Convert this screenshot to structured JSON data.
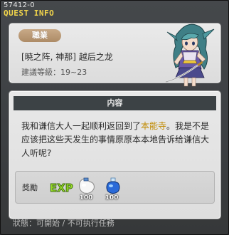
{
  "window": {
    "quest_id": "57412-0",
    "title": "QUEST INFO"
  },
  "summary": {
    "job_label": "職業",
    "quest_name": "[暁之阵, 神那] 越后之龙",
    "level_requirement": "建議等級：19~23"
  },
  "content": {
    "header": "内容",
    "text_part1": "我和谦信大人一起顺利返回到了",
    "text_highlight": "本能寺",
    "text_part2": "。我是不是应该把这些天发生的事情原原本本地告诉给谦信大人听呢?",
    "highlight_color": "#c08a00"
  },
  "reward": {
    "label": "獎勵",
    "exp_text": "EXP",
    "items": [
      {
        "icon": "white-potion-icon",
        "count": "100"
      },
      {
        "icon": "blue-potion-icon",
        "count": "100"
      }
    ]
  },
  "status": {
    "text": "狀態：可開始 / 不可执行任務"
  }
}
